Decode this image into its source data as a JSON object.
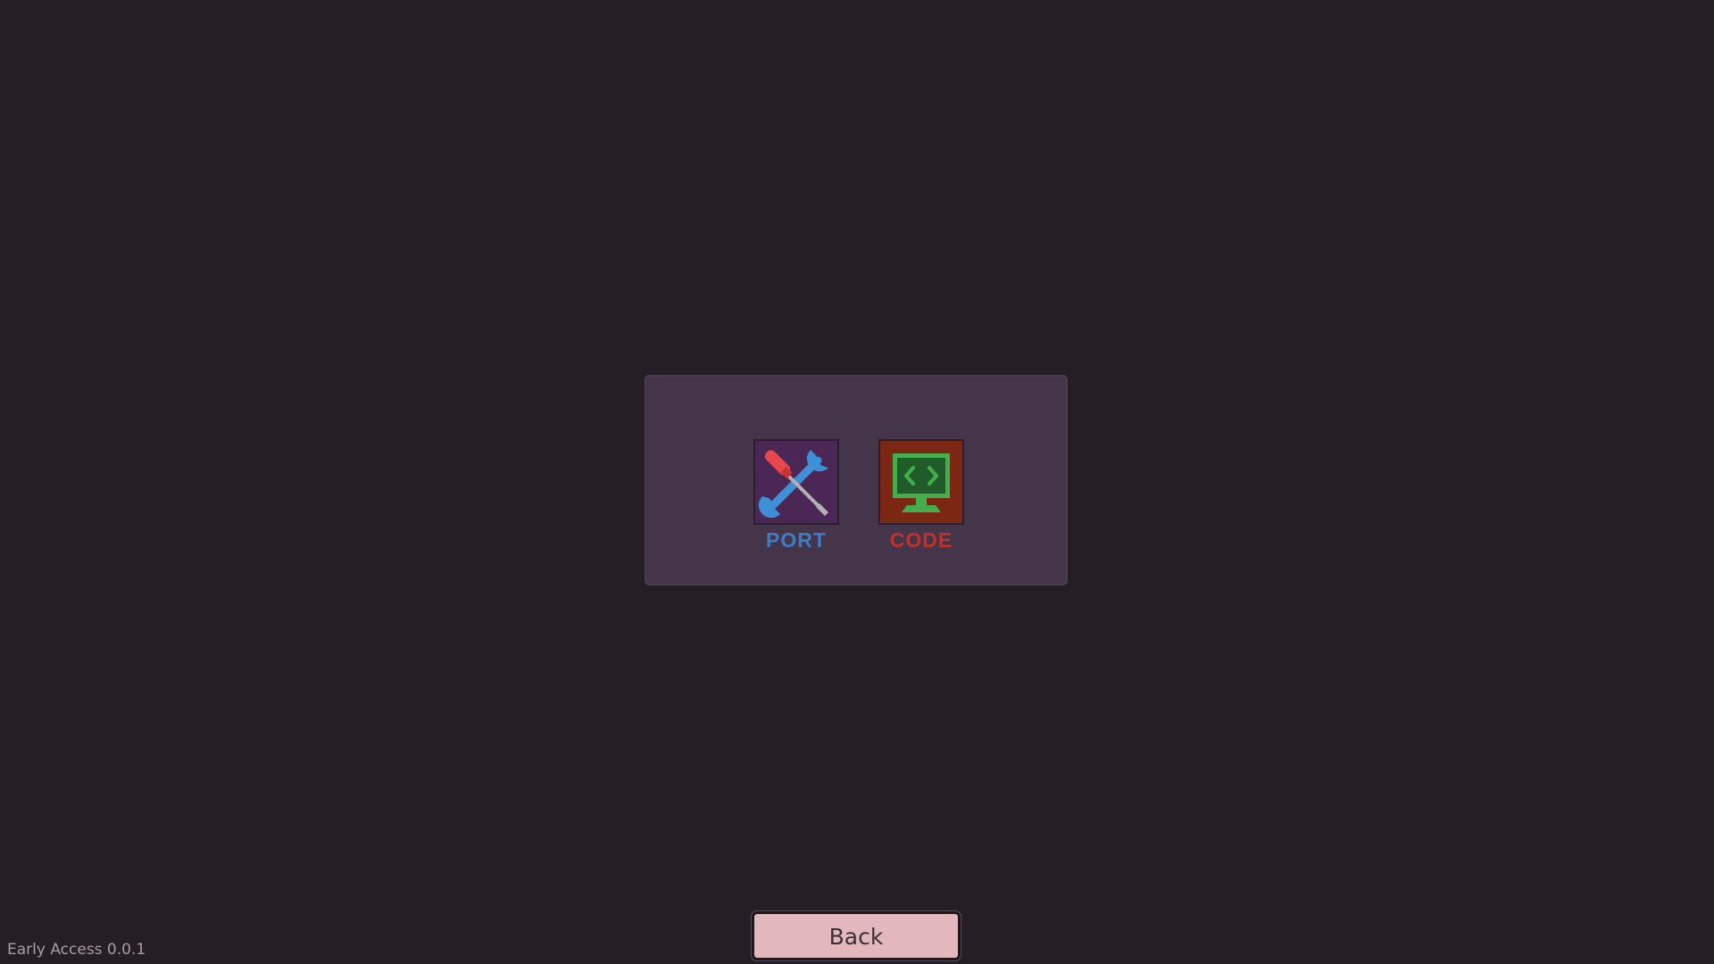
{
  "menu": {
    "tiles": [
      {
        "label": "PORT",
        "icon": "wrench-screwdriver-icon",
        "color": "#3f7cc4",
        "background": "#4b2756"
      },
      {
        "label": "CODE",
        "icon": "code-monitor-icon",
        "color": "#c13328",
        "background": "#7c2713"
      }
    ]
  },
  "footer": {
    "back_label": "Back",
    "version_text": "Early Access 0.0.1"
  },
  "colors": {
    "background": "#251f25",
    "panel": "#45354a",
    "back_button": "#e2b8bd"
  }
}
